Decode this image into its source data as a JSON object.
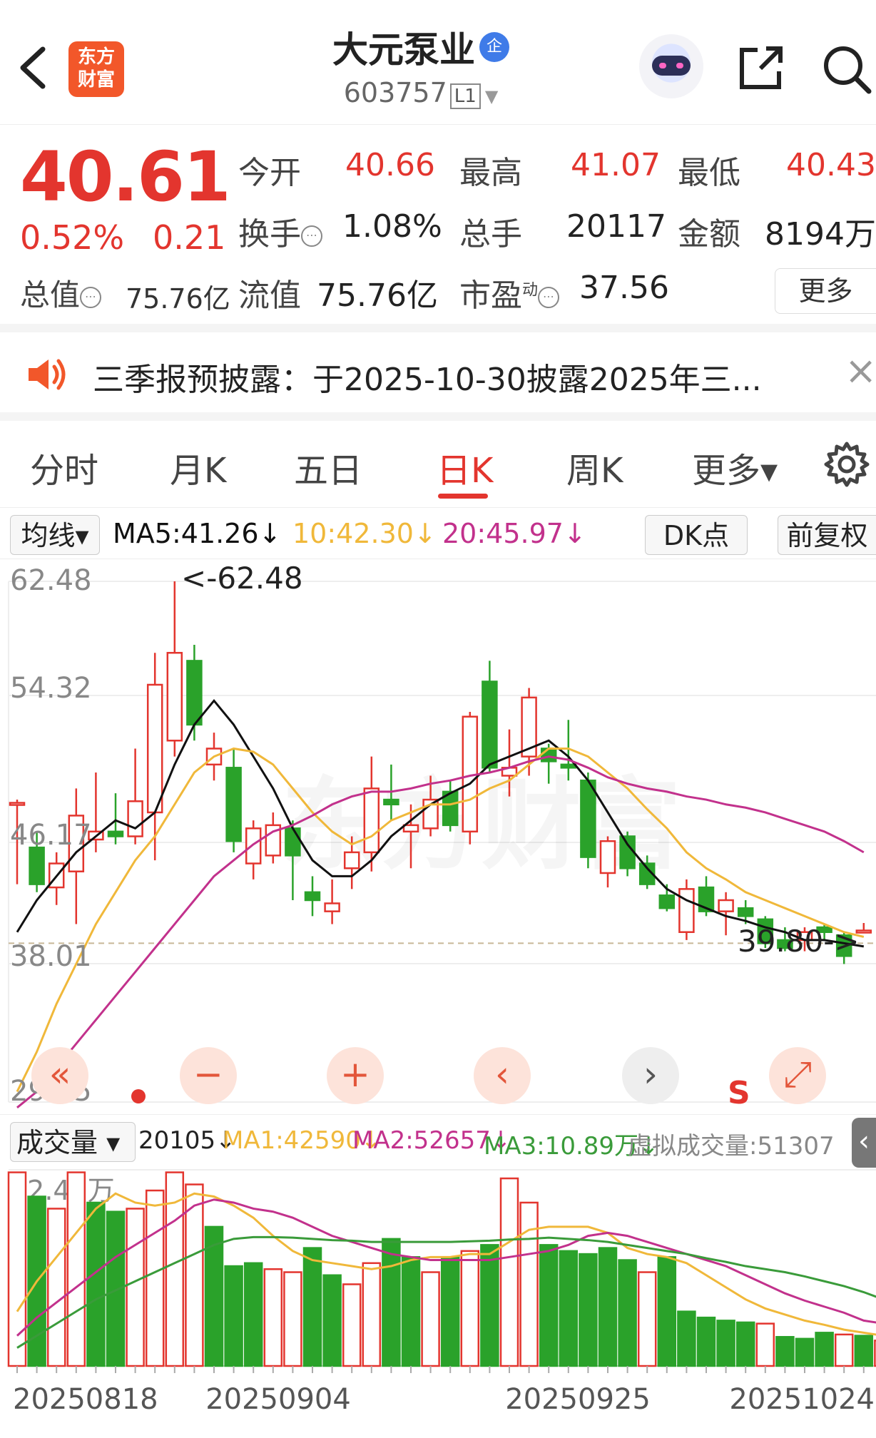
{
  "header": {
    "back_icon": "chevron-left-icon",
    "logo_text_1": "东方",
    "logo_text_2": "财富",
    "stock_name": "大元泵业",
    "badge": "企",
    "code": "603757",
    "level": "L1"
  },
  "quote": {
    "price": "40.61",
    "pct": "0.52%",
    "change": "0.21",
    "open_label": "今开",
    "open": "40.66",
    "high_label": "最高",
    "high": "41.07",
    "low_label": "最低",
    "low": "40.43",
    "turnover_label": "换手",
    "turnover": "1.08%",
    "volume_label": "总手",
    "volume": "20117",
    "amount_label": "金额",
    "amount": "8194万",
    "cap_label": "总值",
    "cap": "75.76亿",
    "float_label": "流值",
    "float": "75.76亿",
    "pe_label": "市盈",
    "pe_sup": "动",
    "pe": "37.56",
    "more": "更多",
    "info_symbol": "⋯"
  },
  "notice": {
    "text": "三季报预披露：于2025-10-30披露2025年三...",
    "close": "×"
  },
  "tabs": [
    "分时",
    "月K",
    "五日",
    "日K",
    "周K",
    "更多▾"
  ],
  "active_tab": "日K",
  "ma": {
    "selector": "均线▾",
    "ma5": "MA5:41.26↓",
    "ma10": "10:42.30↓",
    "ma20": "20:45.97↓",
    "dk": "DK点",
    "adjust": "前复权"
  },
  "chart_labels": {
    "y_top": "62.48",
    "y2": "54.32",
    "y3": "46.17",
    "y4": "38.01",
    "y_bottom": "29.85",
    "max_marker": "<-62.48",
    "min_marker": "39.80->",
    "watermark": "东方财富",
    "s_marker": "S"
  },
  "controls": {
    "prev": "«",
    "zoom_out": "−",
    "zoom_in": "+",
    "left": "‹",
    "right": "›",
    "fullscreen": "⤢"
  },
  "volume": {
    "selector": "成交量 ▾",
    "current": "20105↓",
    "ma1": "MA1:42590↓",
    "ma2": "MA2:52657↓",
    "ma3": "MA3:10.89万↓",
    "virtual": "虚拟成交量:51307",
    "y_top": "32.42万"
  },
  "dates": [
    "20250818",
    "20250904",
    "20250925",
    "20251024"
  ],
  "colors": {
    "up": "#e3352e",
    "down": "#2aa22a",
    "ma5": "#111111",
    "ma10": "#f0b83a",
    "ma20": "#c2318c",
    "vol_ma3": "#3a9b3a"
  },
  "chart_data": {
    "type": "candlestick",
    "y_range": [
      29.85,
      62.48
    ],
    "candles": [
      {
        "o": 48.5,
        "c": 48.6,
        "h": 48.8,
        "l": 43.5,
        "up": true
      },
      {
        "o": 45.8,
        "c": 43.5,
        "h": 46.8,
        "l": 43.0,
        "up": false
      },
      {
        "o": 43.3,
        "c": 44.8,
        "h": 45.5,
        "l": 42.2,
        "up": true
      },
      {
        "o": 44.3,
        "c": 47.8,
        "h": 49.5,
        "l": 41.0,
        "up": true
      },
      {
        "o": 46.3,
        "c": 46.8,
        "h": 50.5,
        "l": 45.5,
        "up": true
      },
      {
        "o": 46.8,
        "c": 46.5,
        "h": 49.2,
        "l": 46.0,
        "up": false
      },
      {
        "o": 46.5,
        "c": 48.7,
        "h": 52.0,
        "l": 46.0,
        "up": true
      },
      {
        "o": 48.0,
        "c": 56.0,
        "h": 58.0,
        "l": 45.0,
        "up": true
      },
      {
        "o": 52.5,
        "c": 58.0,
        "h": 62.48,
        "l": 51.5,
        "up": true
      },
      {
        "o": 57.5,
        "c": 53.5,
        "h": 58.5,
        "l": 52.5,
        "up": false
      },
      {
        "o": 51.0,
        "c": 52.0,
        "h": 53.0,
        "l": 50.0,
        "up": true
      },
      {
        "o": 50.8,
        "c": 46.2,
        "h": 52.0,
        "l": 45.5,
        "up": false
      },
      {
        "o": 44.8,
        "c": 47.0,
        "h": 47.5,
        "l": 43.8,
        "up": true
      },
      {
        "o": 45.3,
        "c": 47.2,
        "h": 48.0,
        "l": 44.8,
        "up": true
      },
      {
        "o": 47.0,
        "c": 45.3,
        "h": 47.5,
        "l": 42.5,
        "up": false
      },
      {
        "o": 43.0,
        "c": 42.5,
        "h": 44.0,
        "l": 41.5,
        "up": false
      },
      {
        "o": 41.8,
        "c": 42.3,
        "h": 43.8,
        "l": 41.0,
        "up": true
      },
      {
        "o": 44.5,
        "c": 45.5,
        "h": 46.5,
        "l": 43.2,
        "up": true
      },
      {
        "o": 45.5,
        "c": 49.5,
        "h": 51.5,
        "l": 44.3,
        "up": true
      },
      {
        "o": 48.8,
        "c": 48.5,
        "h": 51.0,
        "l": 47.5,
        "up": false
      },
      {
        "o": 46.8,
        "c": 47.2,
        "h": 48.5,
        "l": 44.5,
        "up": true
      },
      {
        "o": 47.0,
        "c": 48.8,
        "h": 50.3,
        "l": 46.5,
        "up": true
      },
      {
        "o": 49.3,
        "c": 47.2,
        "h": 50.0,
        "l": 46.8,
        "up": false
      },
      {
        "o": 46.8,
        "c": 54.0,
        "h": 54.3,
        "l": 46.0,
        "up": true
      },
      {
        "o": 56.2,
        "c": 50.8,
        "h": 57.5,
        "l": 50.5,
        "up": false
      },
      {
        "o": 50.3,
        "c": 50.8,
        "h": 53.2,
        "l": 49.0,
        "up": true
      },
      {
        "o": 51.5,
        "c": 55.2,
        "h": 55.8,
        "l": 50.3,
        "up": true
      },
      {
        "o": 52.0,
        "c": 51.2,
        "h": 52.3,
        "l": 49.8,
        "up": false
      },
      {
        "o": 51.0,
        "c": 50.8,
        "h": 53.8,
        "l": 50.0,
        "up": false
      },
      {
        "o": 50.0,
        "c": 45.2,
        "h": 50.5,
        "l": 44.5,
        "up": false
      },
      {
        "o": 44.2,
        "c": 46.2,
        "h": 46.5,
        "l": 43.3,
        "up": true
      },
      {
        "o": 46.5,
        "c": 44.5,
        "h": 46.8,
        "l": 44.0,
        "up": false
      },
      {
        "o": 44.8,
        "c": 43.5,
        "h": 45.3,
        "l": 43.2,
        "up": false
      },
      {
        "o": 42.8,
        "c": 42.0,
        "h": 43.5,
        "l": 41.8,
        "up": false
      },
      {
        "o": 40.5,
        "c": 43.2,
        "h": 43.8,
        "l": 40.0,
        "up": true
      },
      {
        "o": 43.3,
        "c": 41.8,
        "h": 44.0,
        "l": 41.5,
        "up": false
      },
      {
        "o": 42.5,
        "c": 41.8,
        "h": 43.0,
        "l": 40.3,
        "up": true
      },
      {
        "o": 42.0,
        "c": 41.5,
        "h": 42.5,
        "l": 41.0,
        "up": false
      },
      {
        "o": 41.3,
        "c": 39.8,
        "h": 41.5,
        "l": 39.5,
        "up": false
      },
      {
        "o": 39.5,
        "c": 40.0,
        "h": 40.8,
        "l": 39.3,
        "up": false
      },
      {
        "o": 40.0,
        "c": 40.5,
        "h": 40.8,
        "l": 39.3,
        "up": true
      },
      {
        "o": 40.8,
        "c": 40.5,
        "h": 41.0,
        "l": 40.0,
        "up": false
      },
      {
        "o": 40.3,
        "c": 39.0,
        "h": 40.5,
        "l": 38.5,
        "up": false
      },
      {
        "o": 40.6,
        "c": 40.6,
        "h": 41.07,
        "l": 40.43,
        "up": true
      }
    ],
    "ma5": [
      40.5,
      42.5,
      44.0,
      45.5,
      46.5,
      47.5,
      47.0,
      48.0,
      51.0,
      53.5,
      55.0,
      53.5,
      51.5,
      49.5,
      47.0,
      45.0,
      44.0,
      44.0,
      45.0,
      46.5,
      47.5,
      48.5,
      49.2,
      49.8,
      51.0,
      51.5,
      52.0,
      52.5,
      51.5,
      50.0,
      48.0,
      46.0,
      44.5,
      43.2,
      42.5,
      42.0,
      41.5,
      41.2,
      40.8,
      40.5,
      40.0,
      40.0,
      39.8,
      39.6
    ],
    "ma10": [
      30.5,
      33.0,
      36.0,
      38.5,
      41.0,
      43.0,
      45.0,
      46.5,
      48.5,
      50.5,
      51.5,
      52.0,
      51.8,
      51.0,
      49.5,
      48.0,
      46.8,
      46.0,
      46.5,
      47.5,
      48.0,
      48.5,
      48.5,
      48.8,
      49.5,
      50.0,
      51.0,
      52.0,
      52.0,
      51.5,
      50.5,
      49.5,
      48.2,
      47.0,
      45.5,
      44.5,
      43.8,
      43.0,
      42.5,
      42.0,
      41.5,
      41.0,
      40.5,
      40.2
    ],
    "ma20": [
      29.5,
      30.5,
      32.0,
      33.5,
      35.0,
      36.5,
      38.0,
      39.5,
      41.0,
      42.5,
      44.0,
      45.0,
      46.0,
      46.8,
      47.2,
      47.8,
      48.5,
      49.0,
      49.3,
      49.3,
      49.5,
      49.8,
      50.0,
      50.3,
      50.5,
      50.8,
      51.2,
      51.5,
      51.3,
      50.8,
      50.2,
      49.8,
      49.5,
      49.3,
      49.0,
      48.8,
      48.5,
      48.3,
      48.0,
      47.6,
      47.2,
      46.8,
      46.2,
      45.5
    ],
    "volumes": [
      32.0,
      28.0,
      26.0,
      32.0,
      27.0,
      25.5,
      26.0,
      29.0,
      32.0,
      30.0,
      23.0,
      16.5,
      17.0,
      16.0,
      15.5,
      19.5,
      15.0,
      13.5,
      17.0,
      21.0,
      18.0,
      15.5,
      18.0,
      19.0,
      20.0,
      31.0,
      27.0,
      20.0,
      19.0,
      18.5,
      19.5,
      17.5,
      15.5,
      18.0,
      9.0,
      8.0,
      7.5,
      7.2,
      7.0,
      4.8,
      4.5,
      5.5,
      5.2,
      5.0,
      4.2
    ],
    "vol_up": [
      true,
      false,
      true,
      true,
      false,
      false,
      true,
      true,
      true,
      true,
      false,
      false,
      false,
      true,
      true,
      false,
      false,
      true,
      true,
      false,
      false,
      true,
      false,
      true,
      false,
      true,
      true,
      false,
      false,
      false,
      false,
      false,
      true,
      false,
      false,
      false,
      false,
      false,
      true,
      false,
      false,
      false,
      true,
      false,
      true
    ],
    "vol_ma1": [
      9.0,
      14.0,
      18.0,
      22.0,
      26.0,
      28.5,
      27.0,
      26.5,
      27.0,
      28.5,
      28.0,
      26.5,
      24.5,
      21.5,
      19.0,
      17.5,
      17.0,
      16.5,
      16.0,
      16.5,
      17.5,
      18.0,
      18.0,
      18.5,
      18.5,
      20.5,
      22.5,
      23.0,
      23.0,
      23.0,
      22.0,
      19.5,
      18.5,
      18.0,
      17.0,
      15.0,
      13.0,
      11.0,
      9.5,
      8.5,
      7.5,
      6.8,
      6.0,
      5.5,
      5.0
    ],
    "vol_ma2": [
      5.0,
      8.0,
      10.5,
      13.0,
      15.5,
      18.0,
      20.0,
      22.0,
      24.0,
      26.5,
      27.5,
      27.0,
      26.0,
      25.5,
      24.5,
      23.0,
      21.5,
      20.5,
      19.5,
      18.5,
      18.0,
      17.5,
      17.5,
      17.5,
      17.5,
      18.0,
      18.5,
      19.0,
      20.0,
      21.5,
      22.0,
      21.5,
      20.5,
      19.5,
      18.5,
      17.5,
      16.5,
      15.0,
      13.5,
      12.0,
      10.8,
      9.8,
      8.8,
      7.5,
      7.0
    ],
    "vol_ma3": [
      3.0,
      5.0,
      7.0,
      9.0,
      11.0,
      12.5,
      14.0,
      15.5,
      17.0,
      18.5,
      20.0,
      21.0,
      21.3,
      21.3,
      21.2,
      21.0,
      20.8,
      20.7,
      20.5,
      20.5,
      20.5,
      20.5,
      20.5,
      20.6,
      20.7,
      20.9,
      21.0,
      21.2,
      21.0,
      20.8,
      20.5,
      20.0,
      19.5,
      19.0,
      18.5,
      17.8,
      17.2,
      16.5,
      16.0,
      15.5,
      14.8,
      14.0,
      13.2,
      12.2,
      11.0
    ],
    "vol_max": 32.42
  }
}
